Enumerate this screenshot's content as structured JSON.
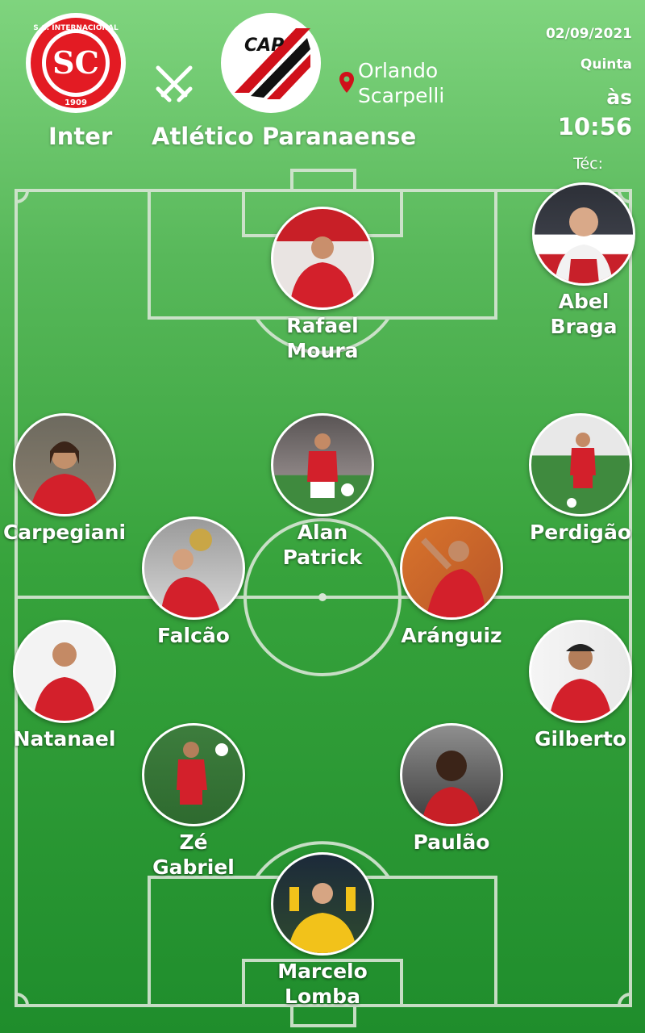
{
  "match": {
    "home_team": "Inter",
    "away_team": "Atlético Paranaense",
    "venue": "Orlando\nScarpelli",
    "date": "02/09/2021",
    "weekday": "Quinta",
    "at_label": "às",
    "time": "10:56",
    "coach_label": "Téc:"
  },
  "home_logo": {
    "ring_text": "S.C. INTERNACIONAL",
    "year": "1909",
    "color": "#e31b23"
  },
  "away_logo": {
    "text": "CAP",
    "colors": [
      "#d0101a",
      "#111111"
    ]
  },
  "icons": {
    "versus": "crossed-swords-icon",
    "location": "map-pin-icon"
  },
  "coach": {
    "name": "Abel\nBraga"
  },
  "players": [
    {
      "id": "rafael-moura",
      "name": "Rafael\nMoura"
    },
    {
      "id": "carpegiani",
      "name": "Carpegiani"
    },
    {
      "id": "alan-patrick",
      "name": "Alan\nPatrick"
    },
    {
      "id": "perdigao",
      "name": "Perdigão"
    },
    {
      "id": "falcao",
      "name": "Falcão"
    },
    {
      "id": "aranguiz",
      "name": "Aránguiz"
    },
    {
      "id": "natanael",
      "name": "Natanael"
    },
    {
      "id": "gilberto",
      "name": "Gilberto"
    },
    {
      "id": "ze-gabriel",
      "name": "Zé\nGabriel"
    },
    {
      "id": "paulao",
      "name": "Paulão"
    },
    {
      "id": "marcelo-lomba",
      "name": "Marcelo\nLomba"
    }
  ],
  "colors": {
    "pitch_line": "#d8e6d5",
    "accent_red": "#d0101a",
    "kit_red": "#d3202b"
  }
}
